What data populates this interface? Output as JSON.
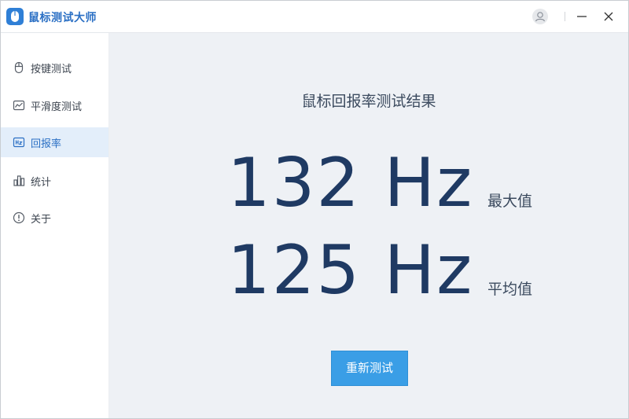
{
  "app": {
    "title": "鼠标测试大师",
    "logo_icon": "mouse-logo-icon",
    "accent_color": "#2f7fd6"
  },
  "window_controls": {
    "user_icon": "user-icon",
    "minimize_icon": "minimize-icon",
    "close_icon": "close-icon"
  },
  "sidebar": {
    "items": [
      {
        "label": "按键测试",
        "icon": "mouse-icon",
        "active": false
      },
      {
        "label": "平滑度测试",
        "icon": "line-chart-icon",
        "active": false
      },
      {
        "label": "回报率",
        "icon": "hz-icon",
        "active": true
      },
      {
        "label": "统计",
        "icon": "bar-chart-icon",
        "active": false
      },
      {
        "label": "关于",
        "icon": "info-icon",
        "active": false
      }
    ]
  },
  "main": {
    "title": "鼠标回报率测试结果",
    "max_value": "132 Hz",
    "max_label": "最大值",
    "avg_value": "125 Hz",
    "avg_label": "平均值",
    "retest_button": "重新测试",
    "button_color": "#3a9ee6"
  }
}
